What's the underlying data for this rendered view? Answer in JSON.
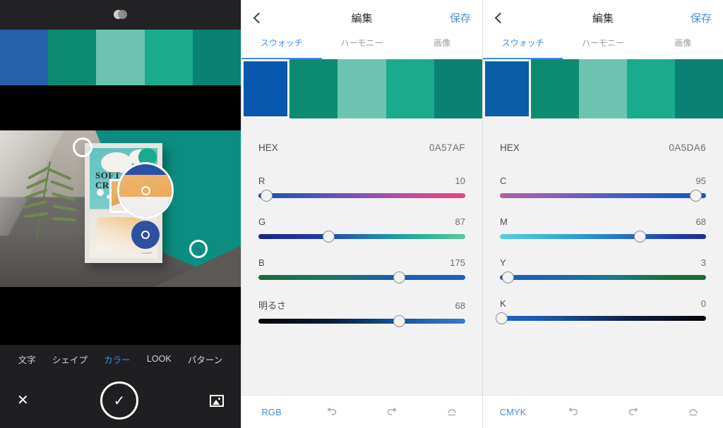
{
  "editor": {
    "topbar": {
      "icon": "blend-circles-icon"
    },
    "palette_strip": [
      "#2660a8",
      "#0d8b72",
      "#6cc3b0",
      "#1aab8e",
      "#0b8176"
    ],
    "artwork": {
      "poster_title_line1": "SOFT",
      "poster_title_line2": "CREAM",
      "poster_credit": "Cream®"
    },
    "tool_tabs": [
      {
        "label": "文字",
        "active": false
      },
      {
        "label": "シェイプ",
        "active": false
      },
      {
        "label": "カラー",
        "active": true
      },
      {
        "label": "LOOK",
        "active": false
      },
      {
        "label": "パターン",
        "active": false
      }
    ],
    "actions": {
      "cancel_icon": "close-icon",
      "confirm_icon": "check-icon",
      "gallery_icon": "image-icon"
    }
  },
  "accent_blue": "#4a90d9",
  "pickers": [
    {
      "header": {
        "back_icon": "back-chevron-icon",
        "title": "編集",
        "save_label": "保存"
      },
      "tabs": [
        {
          "label": "スウォッチ",
          "active": true
        },
        {
          "label": "ハーモニー",
          "active": false
        },
        {
          "label": "画像",
          "active": false
        }
      ],
      "swatches": [
        {
          "color": "#0a57af",
          "selected": true
        },
        {
          "color": "#0d8b72",
          "selected": false
        },
        {
          "color": "#6cc3b0",
          "selected": false
        },
        {
          "color": "#1aab8e",
          "selected": false
        },
        {
          "color": "#0b8176",
          "selected": false
        }
      ],
      "hex": {
        "label": "HEX",
        "value": "0A57AF"
      },
      "sliders": [
        {
          "name": "R",
          "value": "10",
          "percent": 4,
          "gradient": "linear-gradient(90deg,#1a4fa8 0%, #3a56b0 18%, #7a52b5 45%, #b44fa2 70%, #e8467f 100%)"
        },
        {
          "name": "G",
          "value": "87",
          "percent": 34,
          "gradient": "linear-gradient(90deg,#1b1f8e 0%, #1c3fa5 30%, #1f7fb5 55%, #29b39a 80%, #5fc79c 100%)"
        },
        {
          "name": "B",
          "value": "175",
          "percent": 68,
          "gradient": "linear-gradient(90deg,#1b6b39 0%, #177a62 35%, #1660a8 62%, #1a63c0 100%)"
        },
        {
          "name": "明るさ",
          "value": "68",
          "percent": 68,
          "gradient": "linear-gradient(90deg,#050505 0%, #0a1b36 35%, #14519e 66%, #2f7fd1 100%)"
        }
      ],
      "footer": {
        "mode": "RGB",
        "undo_icon": "undo-icon",
        "redo_icon": "redo-icon",
        "reset_icon": "reset-icon"
      }
    },
    {
      "header": {
        "back_icon": "back-chevron-icon",
        "title": "編集",
        "save_label": "保存"
      },
      "tabs": [
        {
          "label": "スウォッチ",
          "active": true
        },
        {
          "label": "ハーモニー",
          "active": false
        },
        {
          "label": "画像",
          "active": false
        }
      ],
      "swatches": [
        {
          "color": "#0a5da6",
          "selected": true
        },
        {
          "color": "#0d8b72",
          "selected": false
        },
        {
          "color": "#6cc3b0",
          "selected": false
        },
        {
          "color": "#1aab8e",
          "selected": false
        },
        {
          "color": "#0b8176",
          "selected": false
        }
      ],
      "hex": {
        "label": "HEX",
        "value": "0A5DA6"
      },
      "sliders": [
        {
          "name": "C",
          "value": "95",
          "percent": 95,
          "gradient": "linear-gradient(90deg,#b05fa8 0%, #8a5fb5 25%, #4a5fc0 55%, #1f5cc0 85%, #1a57bb 100%)"
        },
        {
          "name": "M",
          "value": "68",
          "percent": 68,
          "gradient": "linear-gradient(90deg,#57cfe2 0%, #33a8d8 30%, #1f6fc4 62%, #1b3fa8 85%, #19308f 100%)"
        },
        {
          "name": "Y",
          "value": "3",
          "percent": 4,
          "gradient": "linear-gradient(90deg,#1a5fc0 0%, #1a63b5 20%, #177a8e 55%, #16713f 80%, #1b6b2f 100%)"
        },
        {
          "name": "K",
          "value": "0",
          "percent": 1,
          "gradient": "linear-gradient(90deg,#1f66c6 0%, #1a4fa0 28%, #101f45 62%, #050505 100%)"
        }
      ],
      "footer": {
        "mode": "CMYK",
        "undo_icon": "undo-icon",
        "redo_icon": "redo-icon",
        "reset_icon": "reset-icon"
      }
    }
  ]
}
